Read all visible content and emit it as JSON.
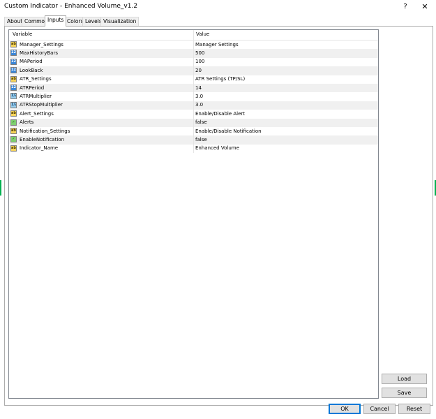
{
  "window": {
    "title": "Custom Indicator - Enhanced Volume_v1.2",
    "help_glyph": "?",
    "close_glyph": "✕"
  },
  "tabs": [
    {
      "label": "About"
    },
    {
      "label": "Common"
    },
    {
      "label": "Inputs"
    },
    {
      "label": "Colors"
    },
    {
      "label": "Levels"
    },
    {
      "label": "Visualization"
    }
  ],
  "active_tab": "Inputs",
  "grid": {
    "headers": {
      "variable": "Variable",
      "value": "Value"
    },
    "rows": [
      {
        "variable": "Manager_Settings",
        "value": "Manager Settings",
        "icon": "string-type-icon",
        "badge": "ab"
      },
      {
        "variable": "MaxHistoryBars",
        "value": "500",
        "icon": "integer-type-icon",
        "badge": "123"
      },
      {
        "variable": "MAPeriod",
        "value": "100",
        "icon": "integer-type-icon",
        "badge": "123"
      },
      {
        "variable": "LookBack",
        "value": "20",
        "icon": "integer-type-icon",
        "badge": "123"
      },
      {
        "variable": "ATR_Settings",
        "value": "ATR Settings (TP/SL)",
        "icon": "string-type-icon",
        "badge": "ab"
      },
      {
        "variable": "ATRPeriod",
        "value": "14",
        "icon": "integer-type-icon",
        "badge": "123"
      },
      {
        "variable": "ATRMultiplier",
        "value": "3.0",
        "icon": "double-type-icon",
        "badge": "1/2"
      },
      {
        "variable": "ATRStopMultiplier",
        "value": "3.0",
        "icon": "double-type-icon",
        "badge": "1/2"
      },
      {
        "variable": "Alert_Settings",
        "value": "Enable/Disable Alert",
        "icon": "string-type-icon",
        "badge": "ab"
      },
      {
        "variable": "Alerts",
        "value": "false",
        "icon": "boolean-type-icon",
        "badge": "✓"
      },
      {
        "variable": "Notification_Settings",
        "value": "Enable/Disable Notification",
        "icon": "string-type-icon",
        "badge": "ab"
      },
      {
        "variable": "EnableNotification",
        "value": "false",
        "icon": "boolean-type-icon",
        "badge": "✓"
      },
      {
        "variable": "Indicator_Name",
        "value": "Enhanced Volume",
        "icon": "string-type-icon",
        "badge": "ab"
      }
    ]
  },
  "buttons": {
    "load": "Load",
    "save": "Save",
    "ok": "OK",
    "cancel": "Cancel",
    "reset": "Reset"
  },
  "colors": {
    "accent": "#0078d7",
    "row_alt": "#f0f0f0",
    "chart_green": "#00b050"
  }
}
